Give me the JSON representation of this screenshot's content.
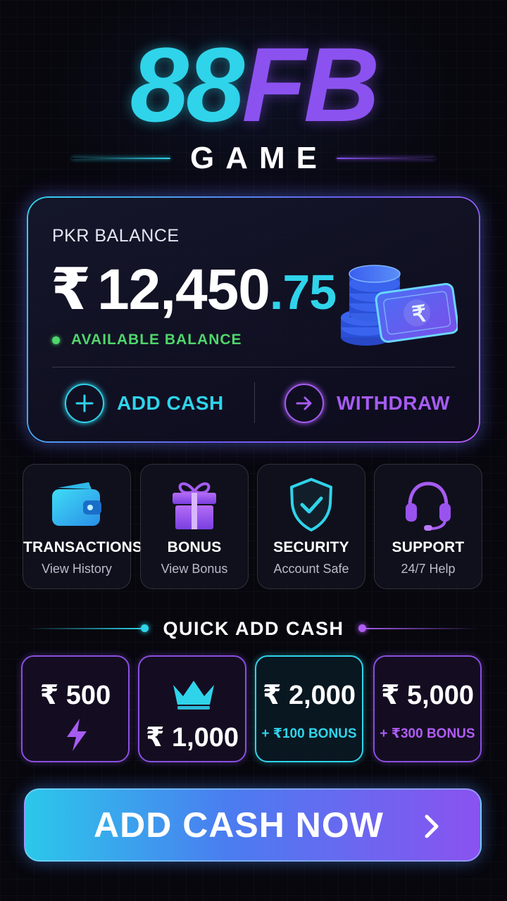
{
  "logo": {
    "main_part1": "88",
    "main_part2": "FB",
    "sub": "GAME"
  },
  "balance": {
    "label": "PKR BALANCE",
    "currency_symbol": "₹",
    "amount_main": "12,450",
    "amount_decimal": ".75",
    "status": "AVAILABLE BALANCE",
    "coin_badge_symbol": "₹"
  },
  "actions": {
    "add_cash": "ADD CASH",
    "withdraw": "WITHDRAW"
  },
  "features": [
    {
      "title": "TRANSACTIONS",
      "subtitle": "View History",
      "icon": "wallet-icon"
    },
    {
      "title": "BONUS",
      "subtitle": "View Bonus",
      "icon": "gift-icon"
    },
    {
      "title": "SECURITY",
      "subtitle": "Account Safe",
      "icon": "shield-check-icon"
    },
    {
      "title": "SUPPORT",
      "subtitle": "24/7 Help",
      "icon": "headset-icon"
    }
  ],
  "quick_add": {
    "title": "QUICK ADD CASH",
    "options": [
      {
        "amount": "₹ 500",
        "icon": "lightning-icon"
      },
      {
        "amount": "₹ 1,000",
        "icon": "crown-icon"
      },
      {
        "amount": "₹ 2,000",
        "bonus": "+ ₹100 BONUS"
      },
      {
        "amount": "₹ 5,000",
        "bonus": "+ ₹300 BONUS"
      }
    ]
  },
  "cta": {
    "label": "ADD CASH NOW",
    "icon": "chevron-right-icon"
  },
  "colors": {
    "cyan": "#2fd4ea",
    "purple": "#8b52f0",
    "green": "#4fd66a",
    "background": "#07070d"
  }
}
